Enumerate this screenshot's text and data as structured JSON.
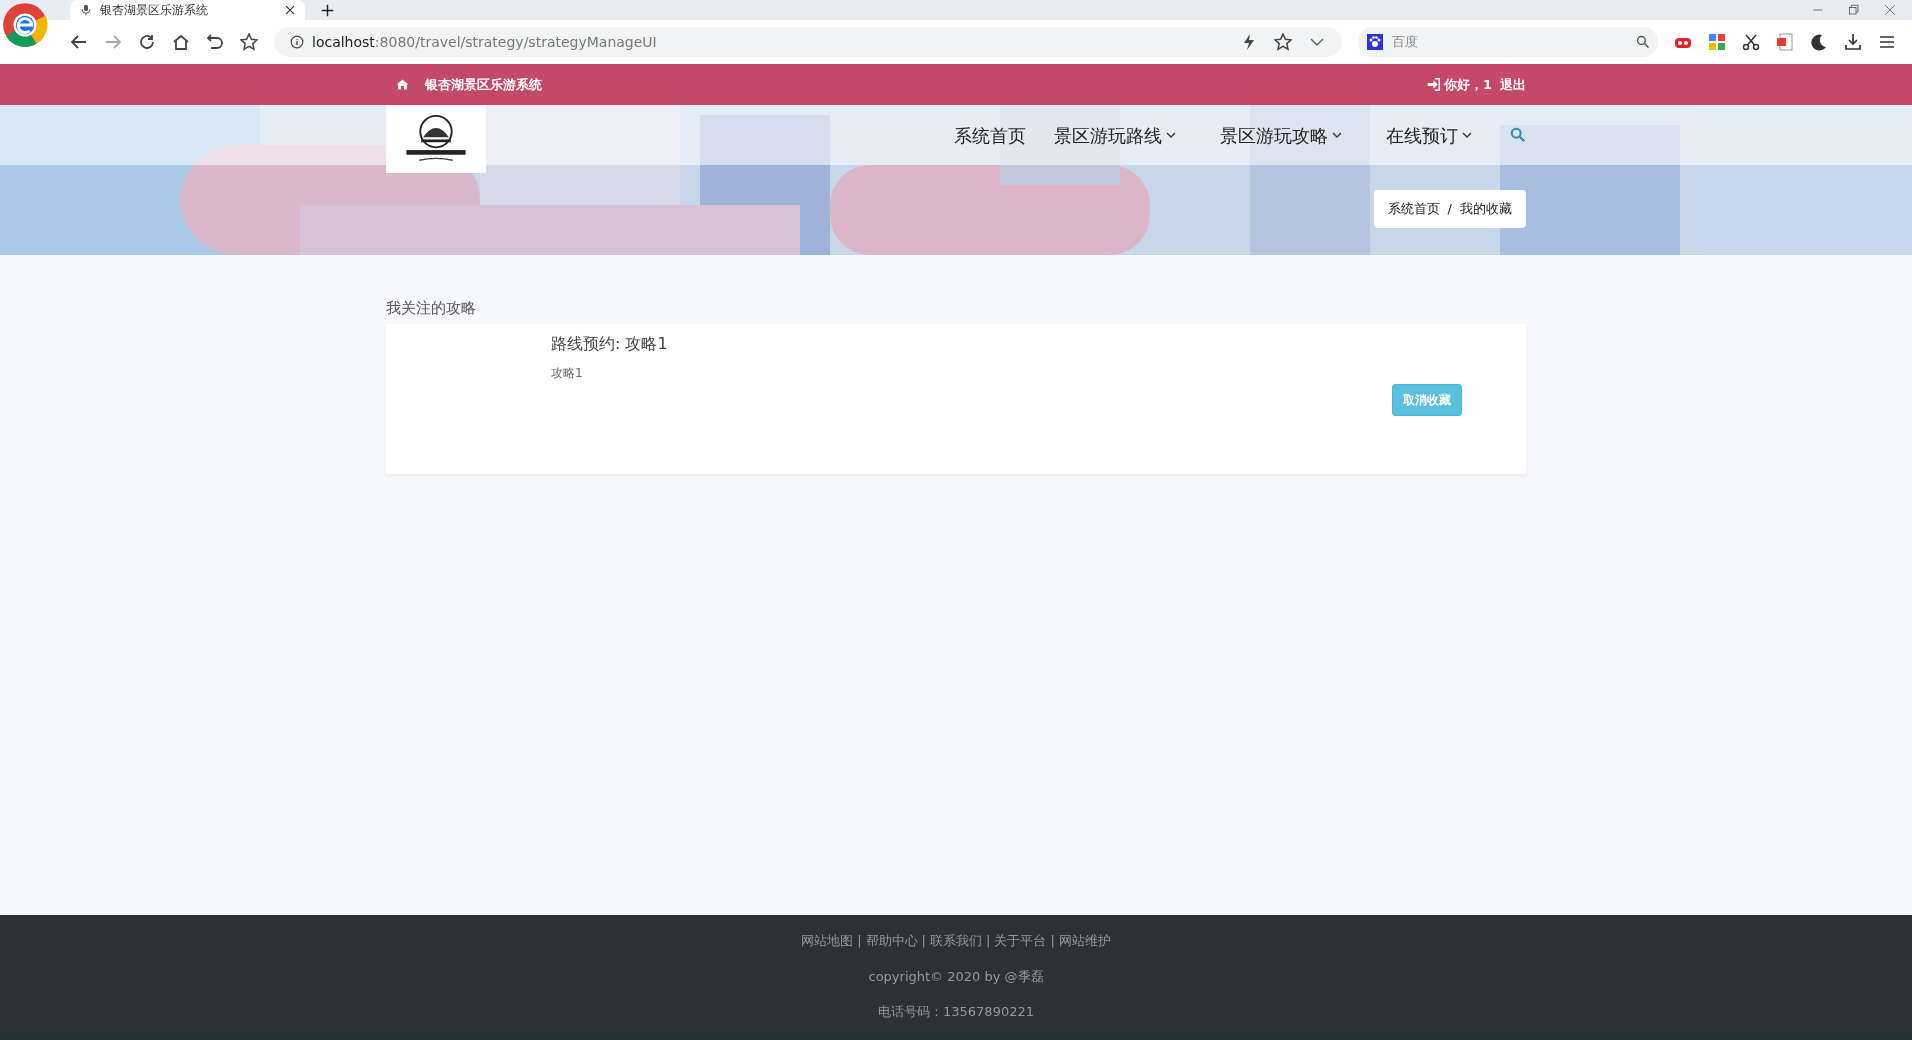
{
  "browser": {
    "tab_title": "银杏湖景区乐游系统",
    "url_host": "localhost",
    "url_path": ":8080/travel/strategy/strategyManageUI",
    "search_placeholder": "百度"
  },
  "topbar": {
    "site_name": "银杏湖景区乐游系统",
    "greeting": "你好，1",
    "logout": "退出"
  },
  "nav": {
    "items": [
      {
        "label": "系统首页",
        "dropdown": false
      },
      {
        "label": "景区游玩路线",
        "dropdown": true
      },
      {
        "label": "景区游玩攻略",
        "dropdown": true
      },
      {
        "label": "在线预订",
        "dropdown": true
      }
    ]
  },
  "breadcrumb": [
    "系统首页",
    "我的收藏"
  ],
  "breadcrumb_separator": "/",
  "section_title": "我关注的攻略",
  "favorites": [
    {
      "title": "路线预约: 攻略1",
      "subtitle": "攻略1",
      "button": "取消收藏"
    }
  ],
  "footer": {
    "links": [
      "网站地图",
      "帮助中心",
      "联系我们",
      "关于平台",
      "网站维护"
    ],
    "separator": "|",
    "copyright": "copyright© 2020 by @季磊",
    "phone": "电话号码：13567890221"
  }
}
